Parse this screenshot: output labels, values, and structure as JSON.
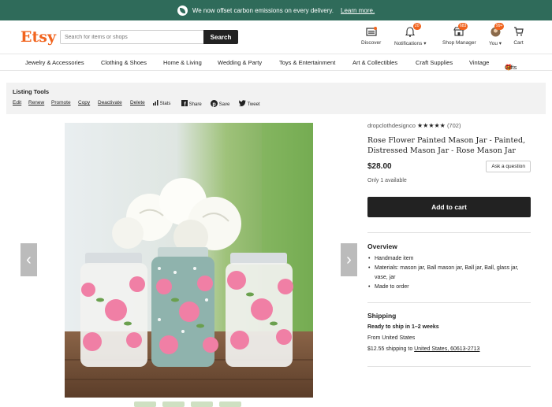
{
  "banner": {
    "text": "We now offset carbon emissions on every delivery.",
    "link": "Learn more."
  },
  "header": {
    "logo": "Etsy",
    "search_placeholder": "Search for items or shops",
    "search_button": "Search",
    "discover": "Discover",
    "notifications": "Notifications",
    "notifications_count": "20",
    "shop_manager": "Shop Manager",
    "shop_manager_count": "683",
    "you": "You",
    "you_count": "99+",
    "cart": "Cart"
  },
  "categories": [
    "Jewelry & Accessories",
    "Clothing & Shoes",
    "Home & Living",
    "Wedding & Party",
    "Toys & Entertainment",
    "Art & Collectibles",
    "Craft Supplies",
    "Vintage",
    "Gifts"
  ],
  "listing_tools": {
    "title": "Listing Tools",
    "links": [
      "Edit",
      "Renew",
      "Promote",
      "Copy",
      "Deactivate",
      "Delete"
    ],
    "stats": "Stats",
    "share": "Share",
    "save": "Save",
    "tweet": "Tweet"
  },
  "product": {
    "shop_name": "dropclothdesignco",
    "stars": "★★★★★",
    "review_count": "(702)",
    "title": "Rose Flower Painted Mason Jar - Painted, Distressed Mason Jar - Rose Mason Jar",
    "price": "$28.00",
    "ask_button": "Ask a question",
    "availability": "Only 1 available",
    "add_to_cart": "Add to cart"
  },
  "overview": {
    "heading": "Overview",
    "items": [
      "Handmade item",
      "Materials: mason jar, Ball mason jar, Ball jar, Ball, glass jar, vase, jar",
      "Made to order"
    ]
  },
  "shipping": {
    "heading": "Shipping",
    "ready": "Ready to ship in 1–2 weeks",
    "from": "From United States",
    "cost_prefix": "$12.55 shipping to",
    "destination": "United States, 60613-2713"
  },
  "icons": [
    "leaf-icon",
    "discover-icon",
    "bell-icon",
    "store-icon",
    "avatar",
    "cart-icon",
    "stats-icon",
    "facebook-icon",
    "pinterest-icon",
    "twitter-icon",
    "chevron-left-icon",
    "chevron-right-icon",
    "gift-icon"
  ],
  "colors": {
    "brand": "#f1641e",
    "banner": "#2f6b5a",
    "dark": "#222222"
  }
}
